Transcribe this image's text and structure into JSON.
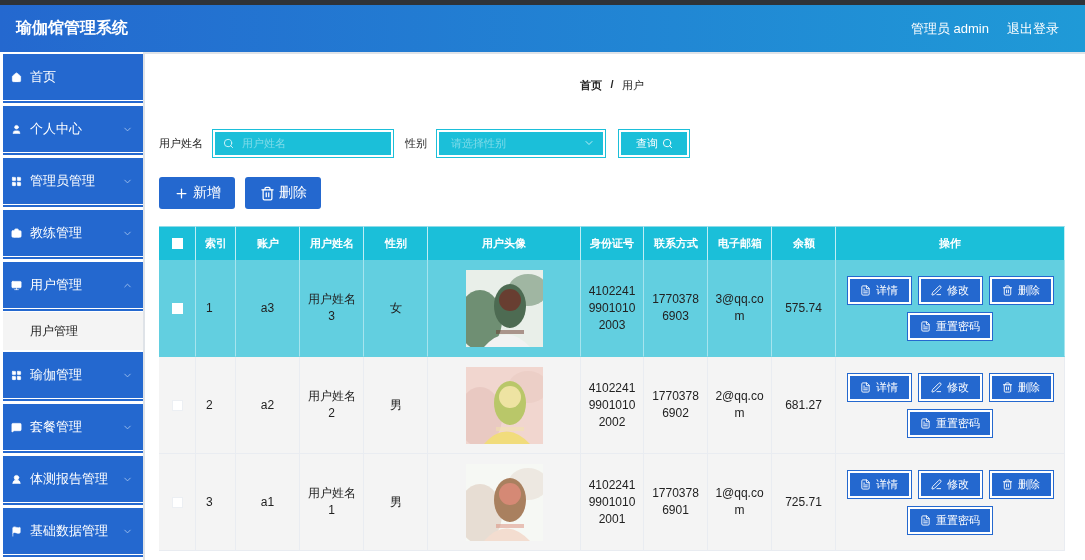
{
  "header": {
    "title": "瑜伽馆管理系统",
    "user": "管理员 admin",
    "logout": "退出登录"
  },
  "sidebar": {
    "items": [
      {
        "label": "首页",
        "expandable": false
      },
      {
        "label": "个人中心",
        "expandable": true,
        "expanded": false
      },
      {
        "label": "管理员管理",
        "expandable": true,
        "expanded": false
      },
      {
        "label": "教练管理",
        "expandable": true,
        "expanded": false
      },
      {
        "label": "用户管理",
        "expandable": true,
        "expanded": true,
        "children": [
          {
            "label": "用户管理"
          }
        ]
      },
      {
        "label": "瑜伽管理",
        "expandable": true,
        "expanded": false
      },
      {
        "label": "套餐管理",
        "expandable": true,
        "expanded": false
      },
      {
        "label": "体测报告管理",
        "expandable": true,
        "expanded": false
      },
      {
        "label": "基础数据管理",
        "expandable": true,
        "expanded": false
      }
    ]
  },
  "breadcrumb": {
    "items": [
      "首页",
      "用户"
    ],
    "separator": "/"
  },
  "filters": {
    "name_label": "用户姓名",
    "name_placeholder": "用户姓名",
    "gender_label": "性别",
    "gender_placeholder": "请选择性别",
    "query_button": "查询"
  },
  "actions": [
    "新增",
    "删除"
  ],
  "table": {
    "columns": [
      "索引",
      "账户",
      "用户姓名",
      "性别",
      "用户头像",
      "身份证号",
      "联系方式",
      "电子邮箱",
      "余额",
      "操作"
    ],
    "header_checked": false,
    "rows": [
      {
        "selected": true,
        "checked": false,
        "index": "1",
        "account": "a3",
        "name": "用户姓名3",
        "gender": "女",
        "id_number": "410224199010102003",
        "phone": "17703786903",
        "email": "3@qq.com",
        "balance": "575.74",
        "buttons": [
          "详情",
          "修改",
          "删除",
          "重置密码"
        ]
      },
      {
        "selected": false,
        "checked": false,
        "index": "2",
        "account": "a2",
        "name": "用户姓名2",
        "gender": "男",
        "id_number": "410224199010102002",
        "phone": "17703786902",
        "email": "2@qq.com",
        "balance": "681.27",
        "buttons": [
          "详情",
          "修改",
          "删除",
          "重置密码"
        ]
      },
      {
        "selected": false,
        "checked": false,
        "index": "3",
        "account": "a1",
        "name": "用户姓名1",
        "gender": "男",
        "id_number": "410224199010102001",
        "phone": "17703786901",
        "email": "1@qq.com",
        "balance": "725.71",
        "buttons": [
          "详情",
          "修改",
          "删除",
          "重置密码"
        ]
      }
    ]
  }
}
